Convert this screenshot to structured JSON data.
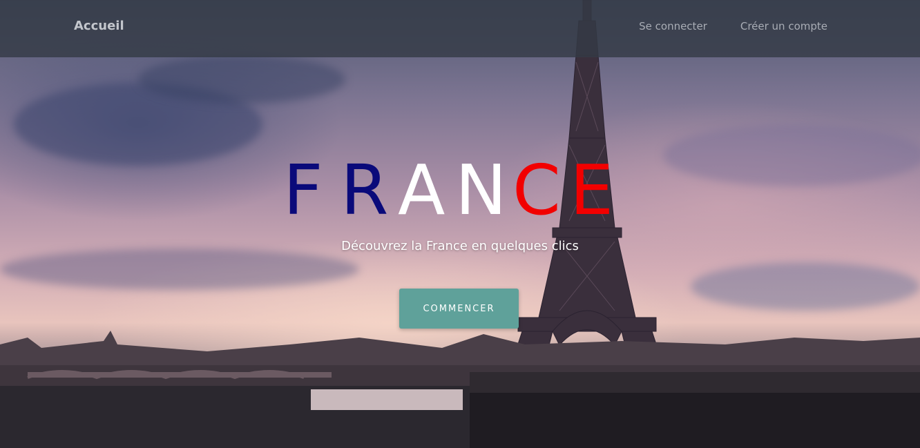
{
  "navbar": {
    "brand": "Accueil",
    "links": [
      "Se connecter",
      "Créer un compte"
    ]
  },
  "hero": {
    "title_letters": [
      {
        "char": "F",
        "color": "#0a0a7a"
      },
      {
        "char": "R",
        "color": "#0a0a7a"
      },
      {
        "char": "A",
        "color": "#ffffff"
      },
      {
        "char": "N",
        "color": "#ffffff"
      },
      {
        "char": "C",
        "color": "#f20000"
      },
      {
        "char": "E",
        "color": "#f20000"
      }
    ],
    "subtitle": "Découvrez la France en quelques clics",
    "cta_label": "COMMENCER",
    "cta_color": "#5fa19a",
    "background_icon": "eiffel-tower-paris-photo"
  }
}
